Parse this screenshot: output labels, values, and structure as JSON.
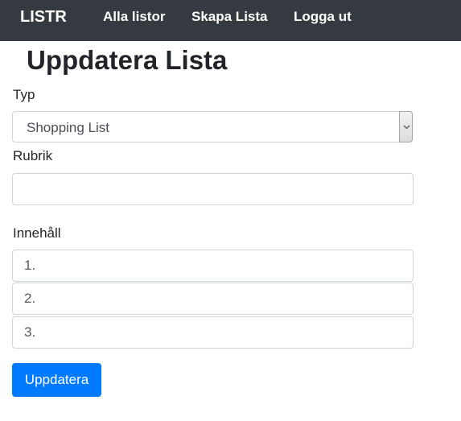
{
  "navbar": {
    "brand": "LISTR",
    "links": [
      "Alla listor",
      "Skapa Lista",
      "Logga ut"
    ]
  },
  "page": {
    "title": "Uppdatera Lista"
  },
  "form": {
    "type_label": "Typ",
    "type_value": "Shopping List",
    "title_label": "Rubrik",
    "title_value": "",
    "content_label": "Innehåll",
    "items": [
      {
        "placeholder": "1.",
        "value": ""
      },
      {
        "placeholder": "2.",
        "value": ""
      },
      {
        "placeholder": "3.",
        "value": ""
      }
    ],
    "submit_label": "Uppdatera"
  },
  "colors": {
    "navbar_bg": "#343a40",
    "primary": "#007bff"
  }
}
